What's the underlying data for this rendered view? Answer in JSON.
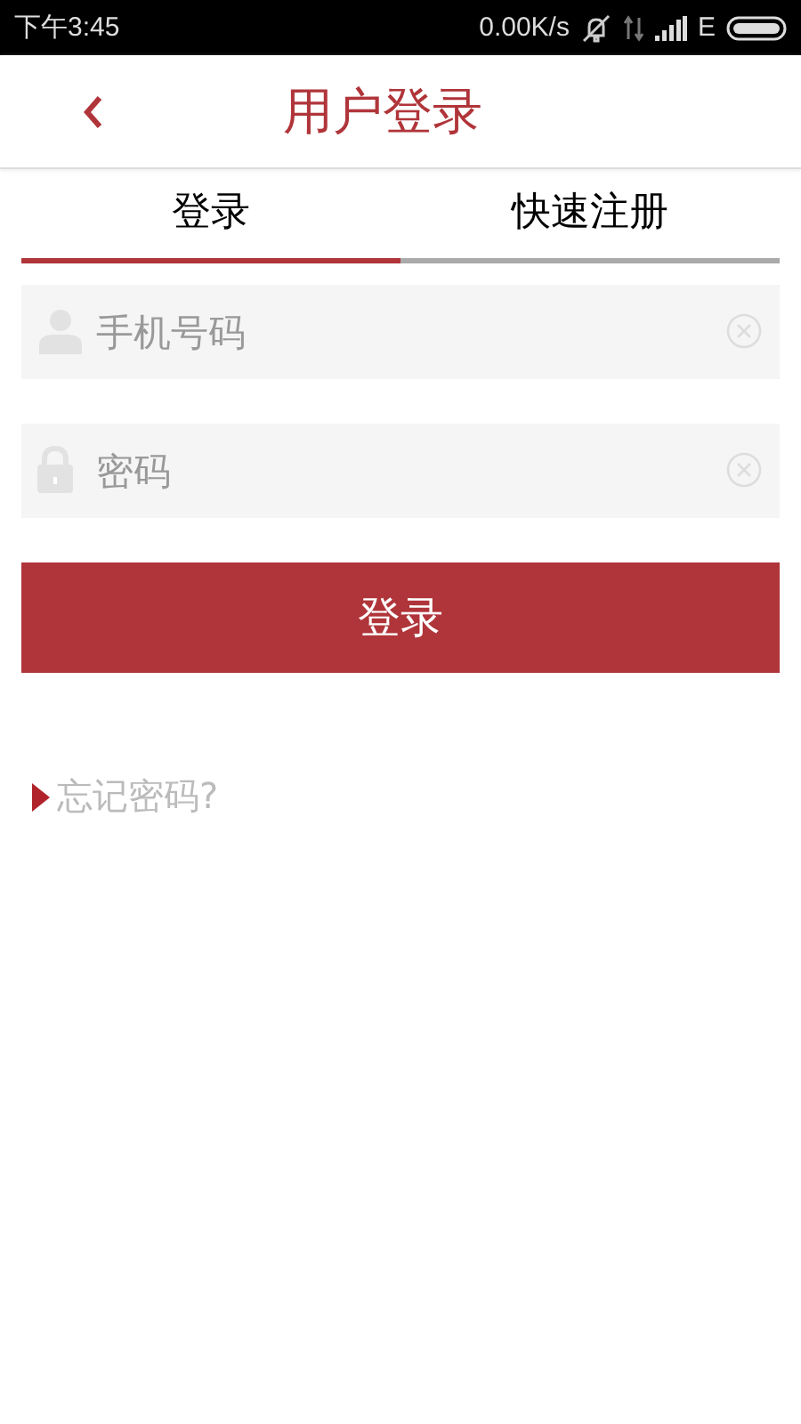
{
  "status_bar": {
    "time": "下午3:45",
    "speed": "0.00K/s",
    "network": "E"
  },
  "header": {
    "title": "用户登录"
  },
  "tabs": [
    {
      "label": "登录",
      "selected": true
    },
    {
      "label": "快速注册",
      "selected": false
    }
  ],
  "fields": [
    {
      "kind": "phone",
      "placeholder": "手机号码"
    },
    {
      "kind": "password",
      "placeholder": "密码"
    }
  ],
  "login_button": "登录",
  "forgot_link": "忘记密码?"
}
